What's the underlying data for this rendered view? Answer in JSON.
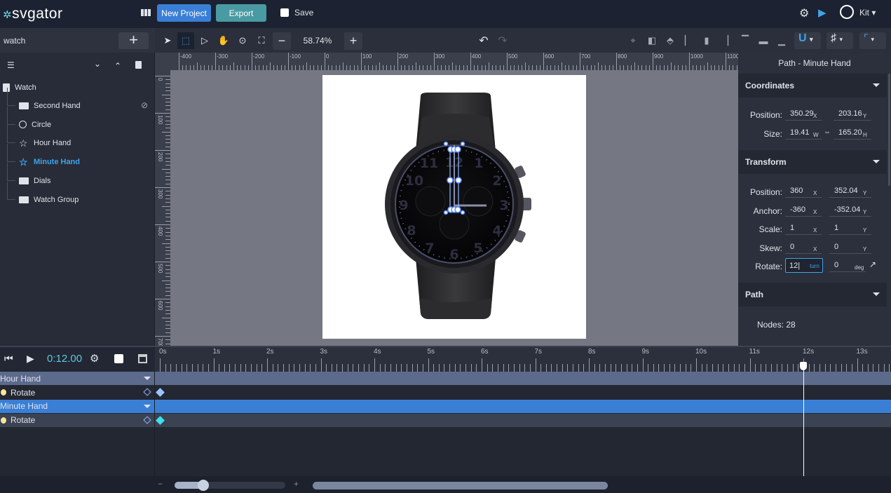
{
  "header": {
    "logo": "svgator",
    "new_project": "New Project",
    "export": "Export",
    "save": "Save",
    "user": "Kit",
    "colors": {
      "new_project": "#3a7fd6",
      "export": "#4a9aa3",
      "accent": "#3fa3e8"
    }
  },
  "layers": {
    "project_name": "watch",
    "root": "Watch",
    "items": [
      {
        "label": "Second Hand",
        "icon": "folder-icon",
        "hidden": true
      },
      {
        "label": "Circle",
        "icon": "circle-icon"
      },
      {
        "label": "Hour Hand",
        "icon": "star-icon"
      },
      {
        "label": "Minute Hand",
        "icon": "star-icon",
        "selected": true
      },
      {
        "label": "Dials",
        "icon": "folder-icon"
      },
      {
        "label": "Watch Group",
        "icon": "folder-icon"
      }
    ]
  },
  "toolbar": {
    "zoom": "58.74%"
  },
  "rulers": {
    "h": [
      "-400",
      "-300",
      "-200",
      "-100",
      "0",
      "100",
      "200",
      "300",
      "400",
      "500",
      "600",
      "700",
      "800",
      "900",
      "1000",
      "1100"
    ],
    "v": [
      "0",
      "100",
      "200",
      "300",
      "400",
      "500",
      "600",
      "700"
    ]
  },
  "inspector": {
    "title": "Path - Minute Hand",
    "coordinates": {
      "heading": "Coordinates",
      "position_label": "Position:",
      "pos_x": "350.29",
      "pos_y": "203.16",
      "size_label": "Size:",
      "w": "19.41",
      "h": "165.20"
    },
    "transform": {
      "heading": "Transform",
      "position_label": "Position:",
      "pos_x": "360",
      "pos_y": "352.04",
      "anchor_label": "Anchor:",
      "anc_x": "-360",
      "anc_y": "-352.04",
      "scale_label": "Scale:",
      "sc_x": "1",
      "sc_y": "1",
      "skew_label": "Skew:",
      "sk_x": "0",
      "sk_y": "0",
      "rotate_label": "Rotate:",
      "rot_turn": "12",
      "rot_deg": "0",
      "turn_unit": "turn",
      "deg_unit": "deg"
    },
    "path": {
      "heading": "Path",
      "nodes": "Nodes: 28"
    },
    "units": {
      "x": "X",
      "y": "Y",
      "w": "W",
      "h": "H"
    }
  },
  "timeline": {
    "time": "0:12.00",
    "ticks": [
      "0s",
      "1s",
      "2s",
      "3s",
      "4s",
      "5s",
      "6s",
      "7s",
      "8s",
      "9s",
      "10s",
      "11s",
      "12s",
      "13s"
    ],
    "playhead_s": 12,
    "tracks": [
      {
        "group": "Hour Hand",
        "prop": "Rotate",
        "keyframes_s": [
          0
        ]
      },
      {
        "group": "Minute Hand",
        "prop": "Rotate",
        "keyframes_s": [
          0
        ],
        "selected": true
      }
    ]
  }
}
